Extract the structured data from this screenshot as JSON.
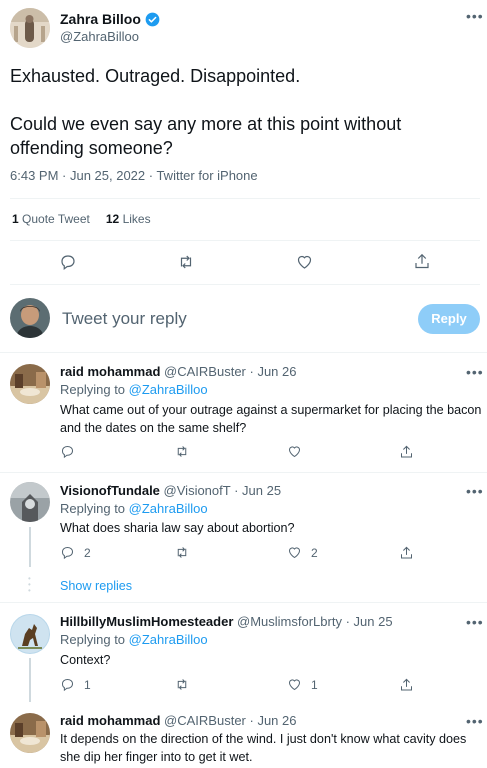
{
  "main_tweet": {
    "author_name": "Zahra Billoo",
    "author_handle": "@ZahraBilloo",
    "text_line1": "Exhausted. Outraged. Disappointed.",
    "text_line2": "Could we even say any more at this point without",
    "text_line3": "offending someone?",
    "meta": "6:43 PM · Jun 25, 2022 · Twitter for iPhone",
    "quote_count": "1",
    "quote_label": "Quote Tweet",
    "like_count": "12",
    "like_label": "Likes"
  },
  "composer": {
    "placeholder": "Tweet your reply",
    "reply_button": "Reply"
  },
  "replies": [
    {
      "name": "raid mohammad",
      "handle": "@CAIRBuster",
      "date": "· Jun 26",
      "replying_prefix": "Replying to",
      "replying_to": "@ZahraBilloo",
      "text1": "What came out of your outrage against a supermarket for placing the bacon",
      "text2": "and the dates on the same shelf?",
      "reply_count": "",
      "like_count": ""
    },
    {
      "name": "VisionofTundale",
      "handle": "@VisionofT",
      "date": "· Jun 25",
      "replying_prefix": "Replying to",
      "replying_to": "@ZahraBilloo",
      "text1": "What does sharia law say about abortion?",
      "reply_count": "2",
      "like_count": "2"
    },
    {
      "name": "HillbillyMuslimHomesteader",
      "handle": "@MuslimsforLbrty",
      "date": "· Jun 25",
      "replying_prefix": "Replying to",
      "replying_to": "@ZahraBilloo",
      "text1": "Context?",
      "reply_count": "1",
      "like_count": "1"
    },
    {
      "name": "raid mohammad",
      "handle": "@CAIRBuster",
      "date": "· Jun 26",
      "text1": "It depends on the direction of the wind. I just don't know what cavity does",
      "text2": "she dip her finger into to get it wet."
    }
  ],
  "show_replies": "Show replies",
  "colors": {
    "accent": "#1d9bf0",
    "reply_button_bg": "#8ecdf8",
    "muted_text": "#536471",
    "divider": "#eff3f4"
  },
  "icons": [
    "verified-badge-icon",
    "more-icon",
    "reply-icon",
    "retweet-icon",
    "like-icon",
    "share-icon"
  ]
}
